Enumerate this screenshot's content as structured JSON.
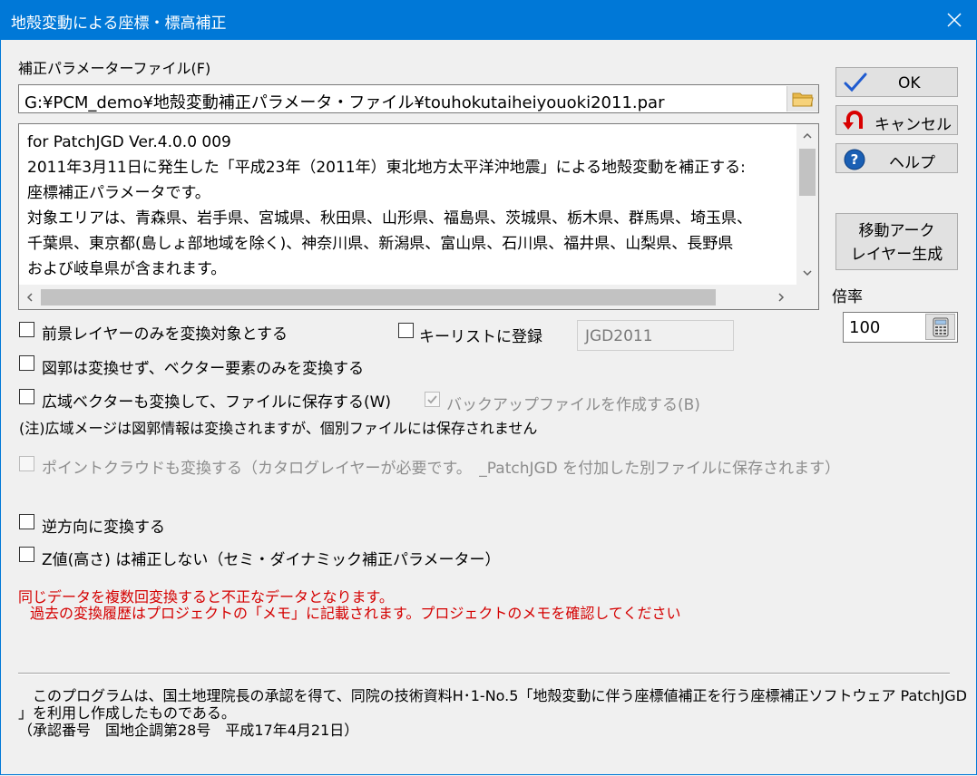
{
  "window": {
    "title": "地殻変動による座標・標高補正"
  },
  "param_file": {
    "label": "補正パラメーターファイル(F)",
    "path": "G:¥PCM_demo¥地殻変動補正パラメータ・ファイル¥touhokutaiheiyouoki2011.par"
  },
  "description": {
    "lines": [
      "for PatchJGD        Ver.4.0.0     009",
      "2011年3月11日に発生した「平成23年（2011年）東北地方太平洋沖地震」による地殻変動を補正する:",
      "座標補正パラメータです。",
      "対象エリアは、青森県、岩手県、宮城県、秋田県、山形県、福島県、茨城県、栃木県、群馬県、埼玉県、",
      "千葉県、東京都(島しょ部地域を除く)、神奈川県、新潟県、富山県、石川県、福井県、山梨県、長野県",
      "および岐阜県が含まれます。"
    ]
  },
  "buttons": {
    "ok": "OK",
    "cancel": "キャンセル",
    "help": "ヘルプ",
    "arc_line1": "移動アーク",
    "arc_line2": "レイヤー生成"
  },
  "rate": {
    "label": "倍率",
    "value": "100"
  },
  "options": {
    "foreground_only": "前景レイヤーのみを変換対象とする",
    "key_list": "キーリストに登録",
    "key_value": "JGD2011",
    "vector_only": "図郭は変換せず、ベクター要素のみを変換する",
    "wide_vector": "広域ベクターも変換して、ファイルに保存する(W)",
    "backup": "バックアップファイルを作成する(B)",
    "wide_note": "(注)広域メージは図郭情報は変換されますが、個別ファイルには保存されません",
    "point_cloud": "ポイントクラウドも変換する（カタログレイヤーが必要です。　_PatchJGD を付加した別ファイルに保存されます）",
    "reverse": "逆方向に変換する",
    "no_z": "Z値(高さ) は補正しない（セミ・ダイナミック補正パラメーター）"
  },
  "warning": {
    "line1": "同じデータを複数回変換すると不正なデータとなります。",
    "line2": "過去の変換履歴はプロジェクトの「メモ」に記載されます。プロジェクトのメモを確認してください"
  },
  "notice": {
    "line1": "　このプログラムは、国土地理院長の承認を得て、同院の技術資料H･1-No.5「地殻変動に伴う座標値補正を行う座標補正ソフトウェア PatchJGD",
    "line2": "」を利用し作成したものである。",
    "line3": "（承認番号　国地企調第28号　平成17年4月21日）"
  },
  "colors": {
    "title_bar": "#0078d7",
    "warning": "#d40000"
  },
  "icons": {
    "close": "close-icon",
    "folder": "folder-icon",
    "ok": "checkmark-icon",
    "cancel": "undo-arrow-icon",
    "help": "question-icon",
    "calculator": "calculator-icon"
  }
}
